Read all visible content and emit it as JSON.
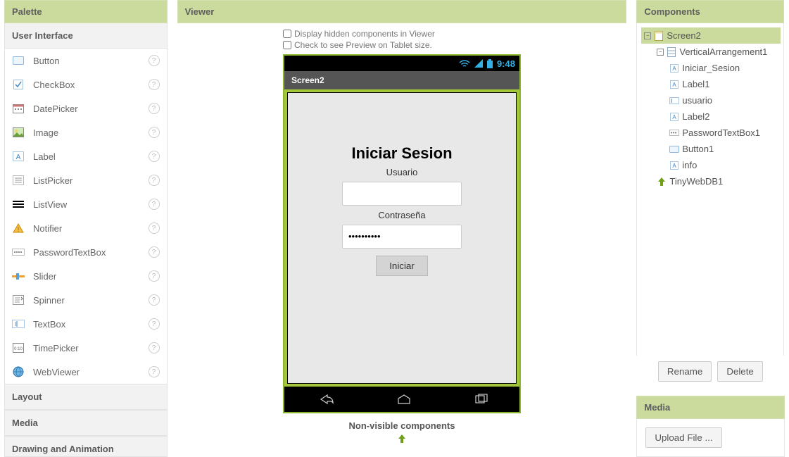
{
  "palette": {
    "title": "Palette",
    "categories": [
      {
        "name": "User Interface",
        "open": true
      },
      {
        "name": "Layout",
        "open": false
      },
      {
        "name": "Media",
        "open": false
      },
      {
        "name": "Drawing and Animation",
        "open": false
      }
    ],
    "ui_items": [
      {
        "label": "Button",
        "icon": "button"
      },
      {
        "label": "CheckBox",
        "icon": "checkbox"
      },
      {
        "label": "DatePicker",
        "icon": "datepicker"
      },
      {
        "label": "Image",
        "icon": "image"
      },
      {
        "label": "Label",
        "icon": "label"
      },
      {
        "label": "ListPicker",
        "icon": "listpicker"
      },
      {
        "label": "ListView",
        "icon": "listview"
      },
      {
        "label": "Notifier",
        "icon": "notifier"
      },
      {
        "label": "PasswordTextBox",
        "icon": "password"
      },
      {
        "label": "Slider",
        "icon": "slider"
      },
      {
        "label": "Spinner",
        "icon": "spinner"
      },
      {
        "label": "TextBox",
        "icon": "textbox"
      },
      {
        "label": "TimePicker",
        "icon": "timepicker"
      },
      {
        "label": "WebViewer",
        "icon": "webviewer"
      }
    ]
  },
  "viewer": {
    "title": "Viewer",
    "opt1": "Display hidden components in Viewer",
    "opt2": "Check to see Preview on Tablet size.",
    "status_time": "9:48",
    "screen_title": "Screen2",
    "app": {
      "heading": "Iniciar Sesion",
      "label_user": "Usuario",
      "label_pass": "Contraseña",
      "password_value": "••••••••••",
      "button": "Iniciar"
    },
    "nonvisible_title": "Non-visible components"
  },
  "components": {
    "title": "Components",
    "tree": {
      "root": "Screen2",
      "children": [
        {
          "name": "VerticalArrangement1",
          "children": [
            "Iniciar_Sesion",
            "Label1",
            "usuario",
            "Label2",
            "PasswordTextBox1",
            "Button1",
            "info"
          ]
        },
        {
          "name": "TinyWebDB1"
        }
      ]
    },
    "rename": "Rename",
    "delete": "Delete"
  },
  "media": {
    "title": "Media",
    "upload": "Upload File ..."
  }
}
